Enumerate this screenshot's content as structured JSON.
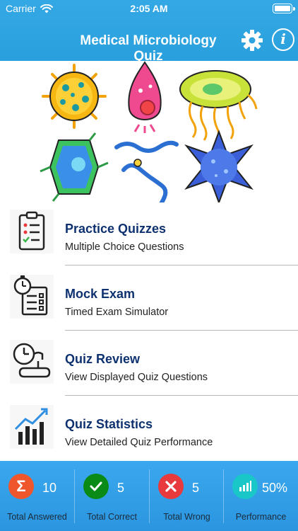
{
  "status_bar": {
    "carrier": "Carrier",
    "time": "2:05 AM"
  },
  "header": {
    "title": "Medical Microbiology Quiz"
  },
  "menu": [
    {
      "title": "Practice Quizzes",
      "subtitle": "Multiple Choice Questions",
      "icon": "clipboard-checklist-icon"
    },
    {
      "title": "Mock Exam",
      "subtitle": "Timed Exam Simulator",
      "icon": "stopwatch-form-icon"
    },
    {
      "title": "Quiz Review",
      "subtitle": "View Displayed Quiz Questions",
      "icon": "clock-scroll-icon"
    },
    {
      "title": "Quiz Statistics",
      "subtitle": "View Detailed Quiz Performance",
      "icon": "bar-chart-trend-icon"
    }
  ],
  "stats": [
    {
      "label": "Total Answered",
      "value": "10",
      "symbol": "Σ",
      "color": "#f0562b"
    },
    {
      "label": "Total Correct",
      "value": "5",
      "symbol": "✓",
      "color": "#0a8a17"
    },
    {
      "label": "Total Wrong",
      "value": "5",
      "symbol": "✕",
      "color": "#e8393c"
    },
    {
      "label": "Performance",
      "value": "50%",
      "symbol": "bars",
      "color": "#19c7c9"
    }
  ],
  "colors": {
    "header": "#2ea3e0",
    "footer": "#3aa7ee",
    "menu_title": "#0e3170"
  }
}
